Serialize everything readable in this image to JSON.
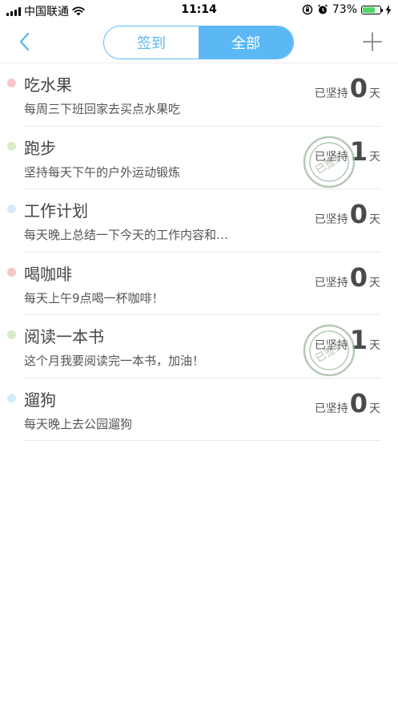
{
  "status_bar": {
    "carrier": "中国联通",
    "time": "11:14",
    "battery": "73%",
    "battery_level": 0.73
  },
  "nav": {
    "tabs": [
      {
        "label": "签到",
        "active": false
      },
      {
        "label": "全部",
        "active": true
      }
    ]
  },
  "stamp_text": "已签到",
  "streak_prefix": "已坚持",
  "streak_suffix": "天",
  "habits": [
    {
      "title": "吃水果",
      "desc": "每周三下班回家去买点水果吃",
      "days": "0",
      "dot_color": "#f4c7cb",
      "signed": false
    },
    {
      "title": "跑步",
      "desc": "坚持每天下午的户外运动锻炼",
      "days": "1",
      "dot_color": "#d8ecc6",
      "signed": true
    },
    {
      "title": "工作计划",
      "desc": "每天晚上总结一下今天的工作内容和…",
      "days": "0",
      "dot_color": "#d6ebf7",
      "signed": false
    },
    {
      "title": "喝咖啡",
      "desc": "每天上午9点喝一杯咖啡！",
      "days": "0",
      "dot_color": "#f4c7cb",
      "signed": false
    },
    {
      "title": "阅读一本书",
      "desc": "这个月我要阅读完一本书，加油！",
      "days": "1",
      "dot_color": "#d8ecc6",
      "signed": true
    },
    {
      "title": "遛狗",
      "desc": "每天晚上去公园遛狗",
      "days": "0",
      "dot_color": "#d6ebf7",
      "signed": false
    }
  ]
}
